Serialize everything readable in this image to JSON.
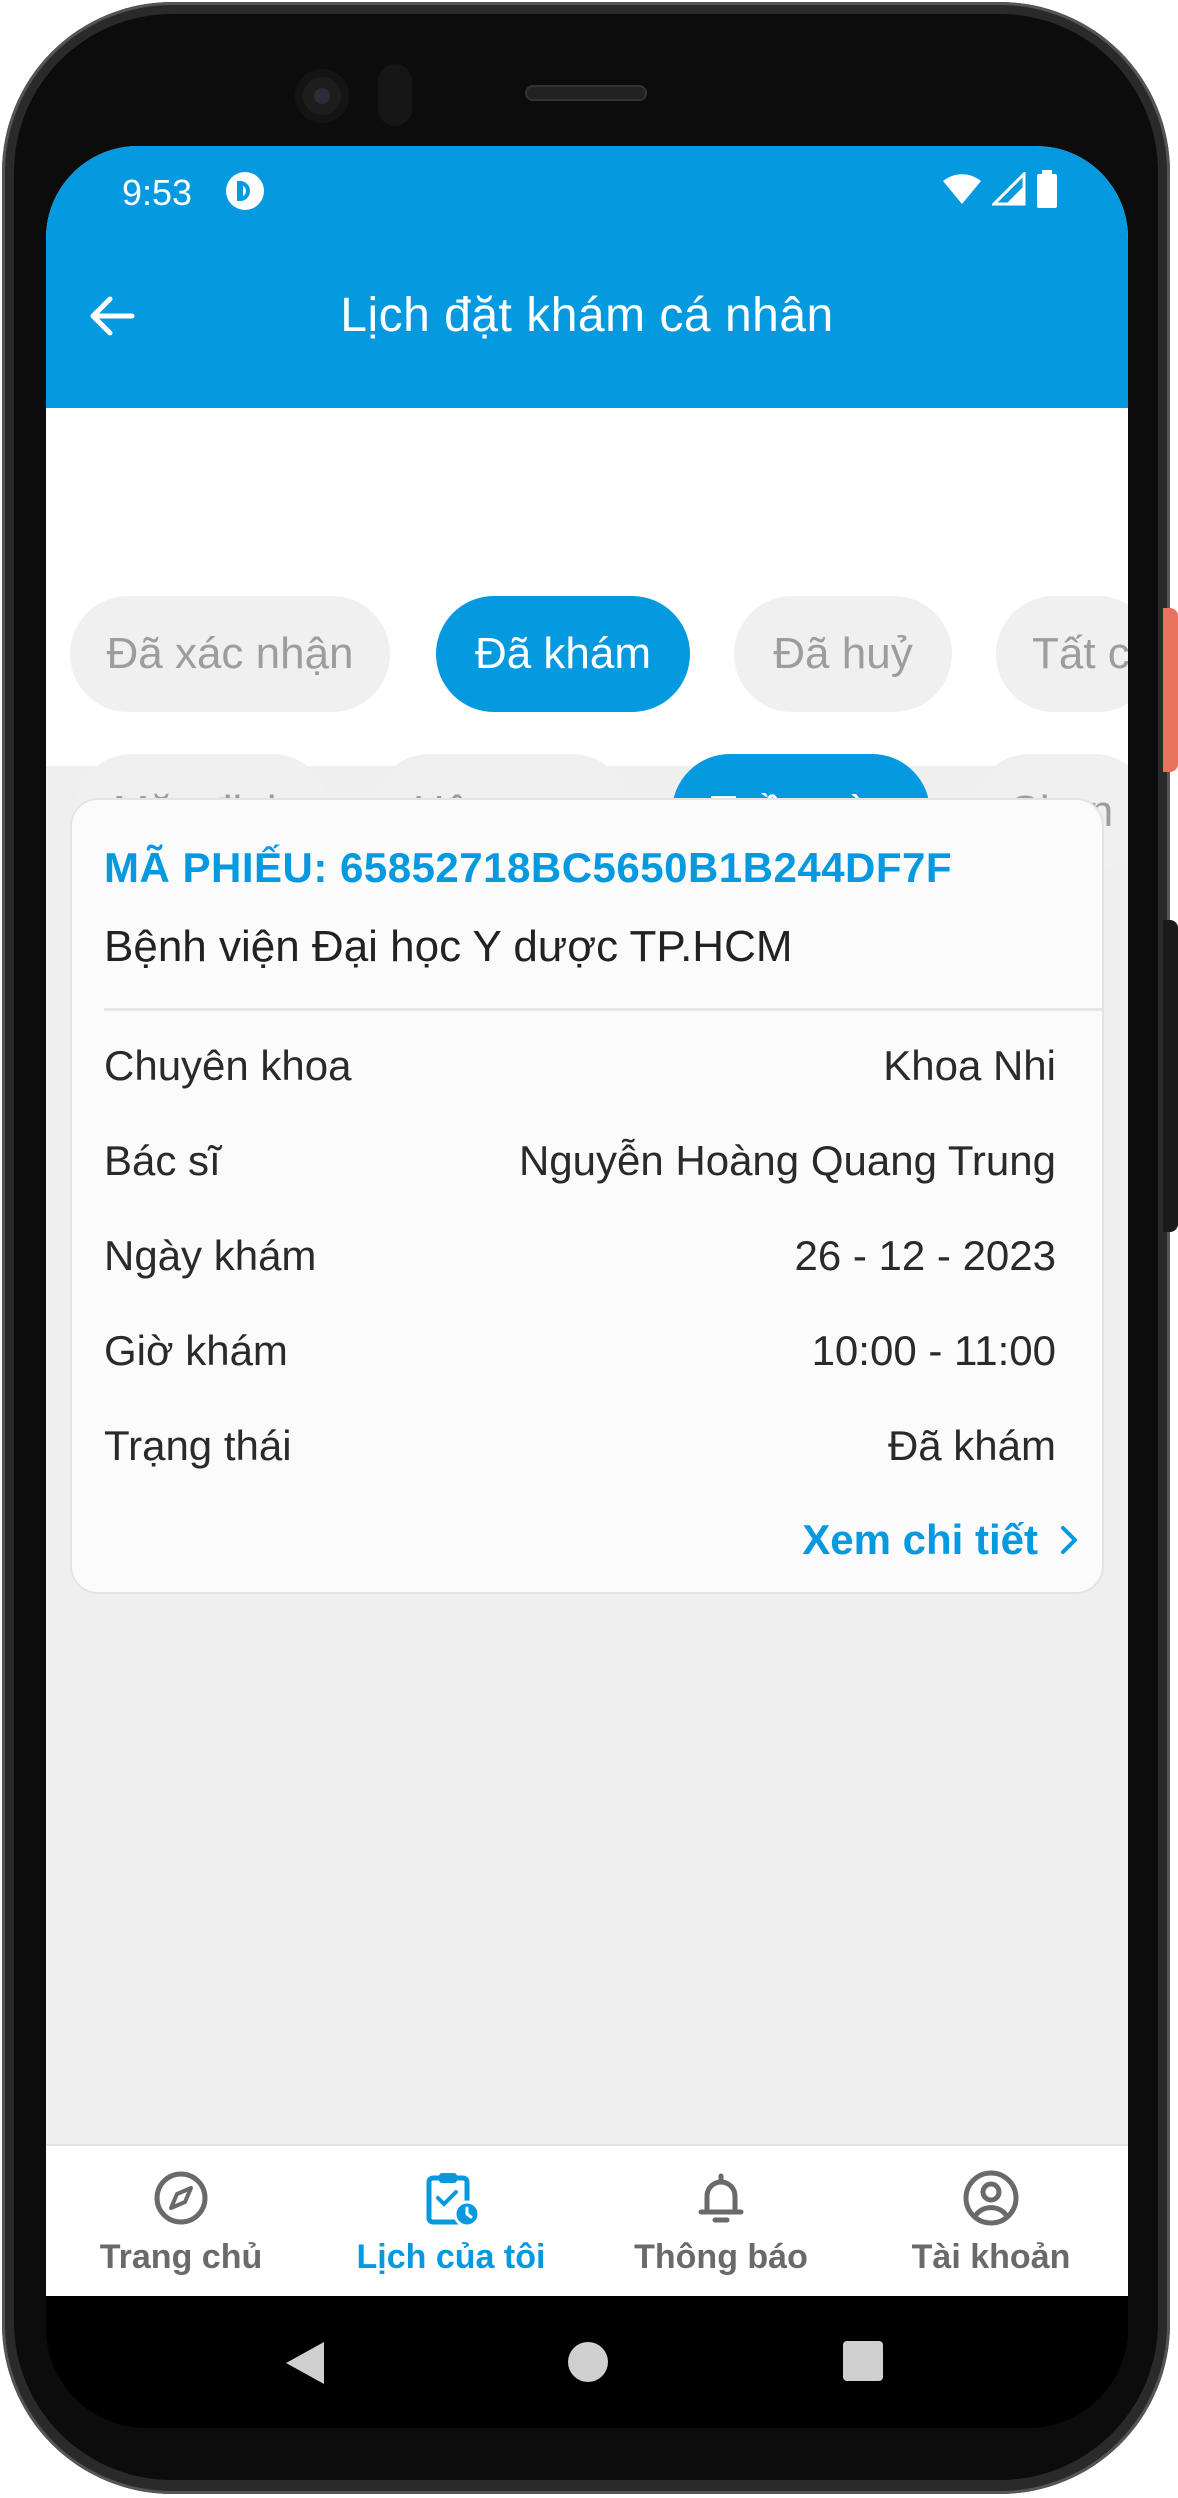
{
  "status_bar": {
    "time": "9:53"
  },
  "app_bar": {
    "title": "Lịch đặt khám cá nhân"
  },
  "status_filters": [
    {
      "label": "Đã xác nhận",
      "active": false
    },
    {
      "label": "Đã khám",
      "active": true
    },
    {
      "label": "Đã huỷ",
      "active": false
    },
    {
      "label": "Tất c",
      "active": false
    }
  ],
  "time_filters": [
    {
      "label": "Mặc định",
      "active": false
    },
    {
      "label": "Hôm nay",
      "active": false
    },
    {
      "label": "Tuần này",
      "active": true
    },
    {
      "label": "Chọn",
      "active": false
    }
  ],
  "appointment": {
    "ticket": "MÃ PHIẾU: 65852718BC5650B1B244DF7F",
    "hospital": "Bệnh viện Đại học Y dược TP.HCM",
    "rows": [
      {
        "label": "Chuyên khoa",
        "value": "Khoa Nhi"
      },
      {
        "label": "Bác sĩ",
        "value": "Nguyễn Hoàng Quang Trung"
      },
      {
        "label": "Ngày khám",
        "value": "26 - 12 - 2023"
      },
      {
        "label": "Giờ khám",
        "value": "10:00 - 11:00"
      },
      {
        "label": "Trạng thái",
        "value": "Đã khám"
      }
    ],
    "detail_link": "Xem chi tiết"
  },
  "bottom_nav": [
    {
      "label": "Trang chủ",
      "icon": "compass-icon",
      "active": false
    },
    {
      "label": "Lịch của tôi",
      "icon": "calendar-clock-icon",
      "active": true
    },
    {
      "label": "Thông báo",
      "icon": "bell-icon",
      "active": false
    },
    {
      "label": "Tài khoản",
      "icon": "account-circle-icon",
      "active": false
    }
  ],
  "colors": {
    "primary": "#0599e0",
    "chip_inactive": "#f0f0f0",
    "background": "#efefef"
  }
}
